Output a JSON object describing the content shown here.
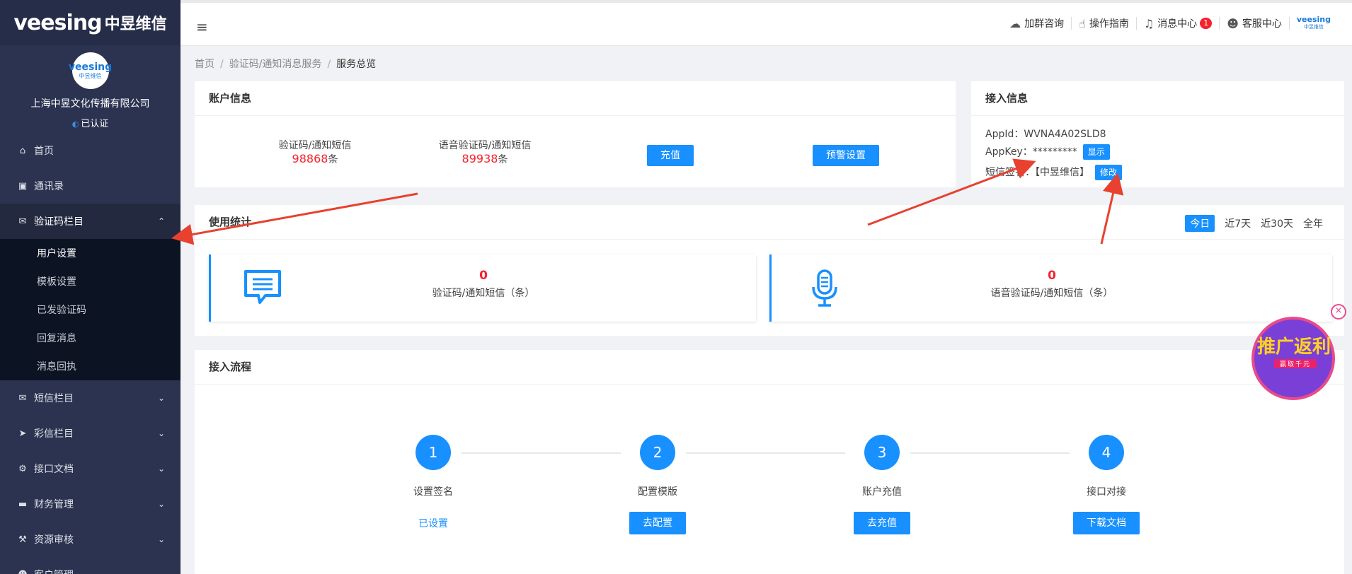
{
  "sidebar": {
    "logo": "veesing",
    "logo_cn": "中昱维信",
    "avatar_text": "veesing",
    "avatar_sub": "中昱维信",
    "company": "上海中昱文化传播有限公司",
    "verified": "已认证",
    "menu": [
      {
        "label": "首页",
        "icon": "home-icon"
      },
      {
        "label": "通讯录",
        "icon": "contacts-icon"
      },
      {
        "label": "验证码栏目",
        "icon": "envelope-open-icon",
        "expanded": true,
        "children": [
          "用户设置",
          "模板设置",
          "已发验证码",
          "回复消息",
          "消息回执"
        ]
      },
      {
        "label": "短信栏目",
        "icon": "envelope-icon"
      },
      {
        "label": "彩信栏目",
        "icon": "send-icon"
      },
      {
        "label": "接口文档",
        "icon": "cogs-icon"
      },
      {
        "label": "财务管理",
        "icon": "credit-card-icon"
      },
      {
        "label": "资源审核",
        "icon": "gavel-icon"
      },
      {
        "label": "客户管理",
        "icon": "user-icon"
      }
    ]
  },
  "header": {
    "items": [
      "加群咨询",
      "操作指南",
      "消息中心",
      "客服中心"
    ],
    "badge": "1",
    "mini_logo_1": "veesing",
    "mini_logo_2": "中昱维信"
  },
  "breadcrumb": [
    "首页",
    "验证码/通知消息服务",
    "服务总览"
  ],
  "account": {
    "title": "账户信息",
    "sms_label": "验证码/通知短信",
    "sms_value": "98868",
    "voice_label": "语音验证码/通知短信",
    "voice_value": "89938",
    "unit": "条",
    "recharge": "充值",
    "alert": "预警设置"
  },
  "access": {
    "title": "接入信息",
    "appid": "AppId：WVNA4A02SLD8",
    "appkey": "AppKey：*********",
    "show": "显示",
    "sign": "短信签名：【中昱维信】",
    "edit": "修改"
  },
  "usage": {
    "title": "使用统计",
    "tabs": [
      "今日",
      "近7天",
      "近30天",
      "全年"
    ],
    "sms_count": "0",
    "sms_label": "验证码/通知短信（条）",
    "voice_count": "0",
    "voice_label": "语音验证码/通知短信（条）"
  },
  "flow": {
    "title": "接入流程",
    "steps": [
      {
        "num": "1",
        "label": "设置签名",
        "action": "已设置"
      },
      {
        "num": "2",
        "label": "配置模版",
        "action": "去配置"
      },
      {
        "num": "3",
        "label": "账户充值",
        "action": "去充值"
      },
      {
        "num": "4",
        "label": "接口对接",
        "action": "下载文档"
      }
    ]
  },
  "promo": {
    "title": "推广返利",
    "sub": "赢取千元",
    "close": "×"
  },
  "colors": {
    "accent": "#1890ff",
    "sidebar": "#2b3350",
    "highlight": "#f5222d"
  }
}
